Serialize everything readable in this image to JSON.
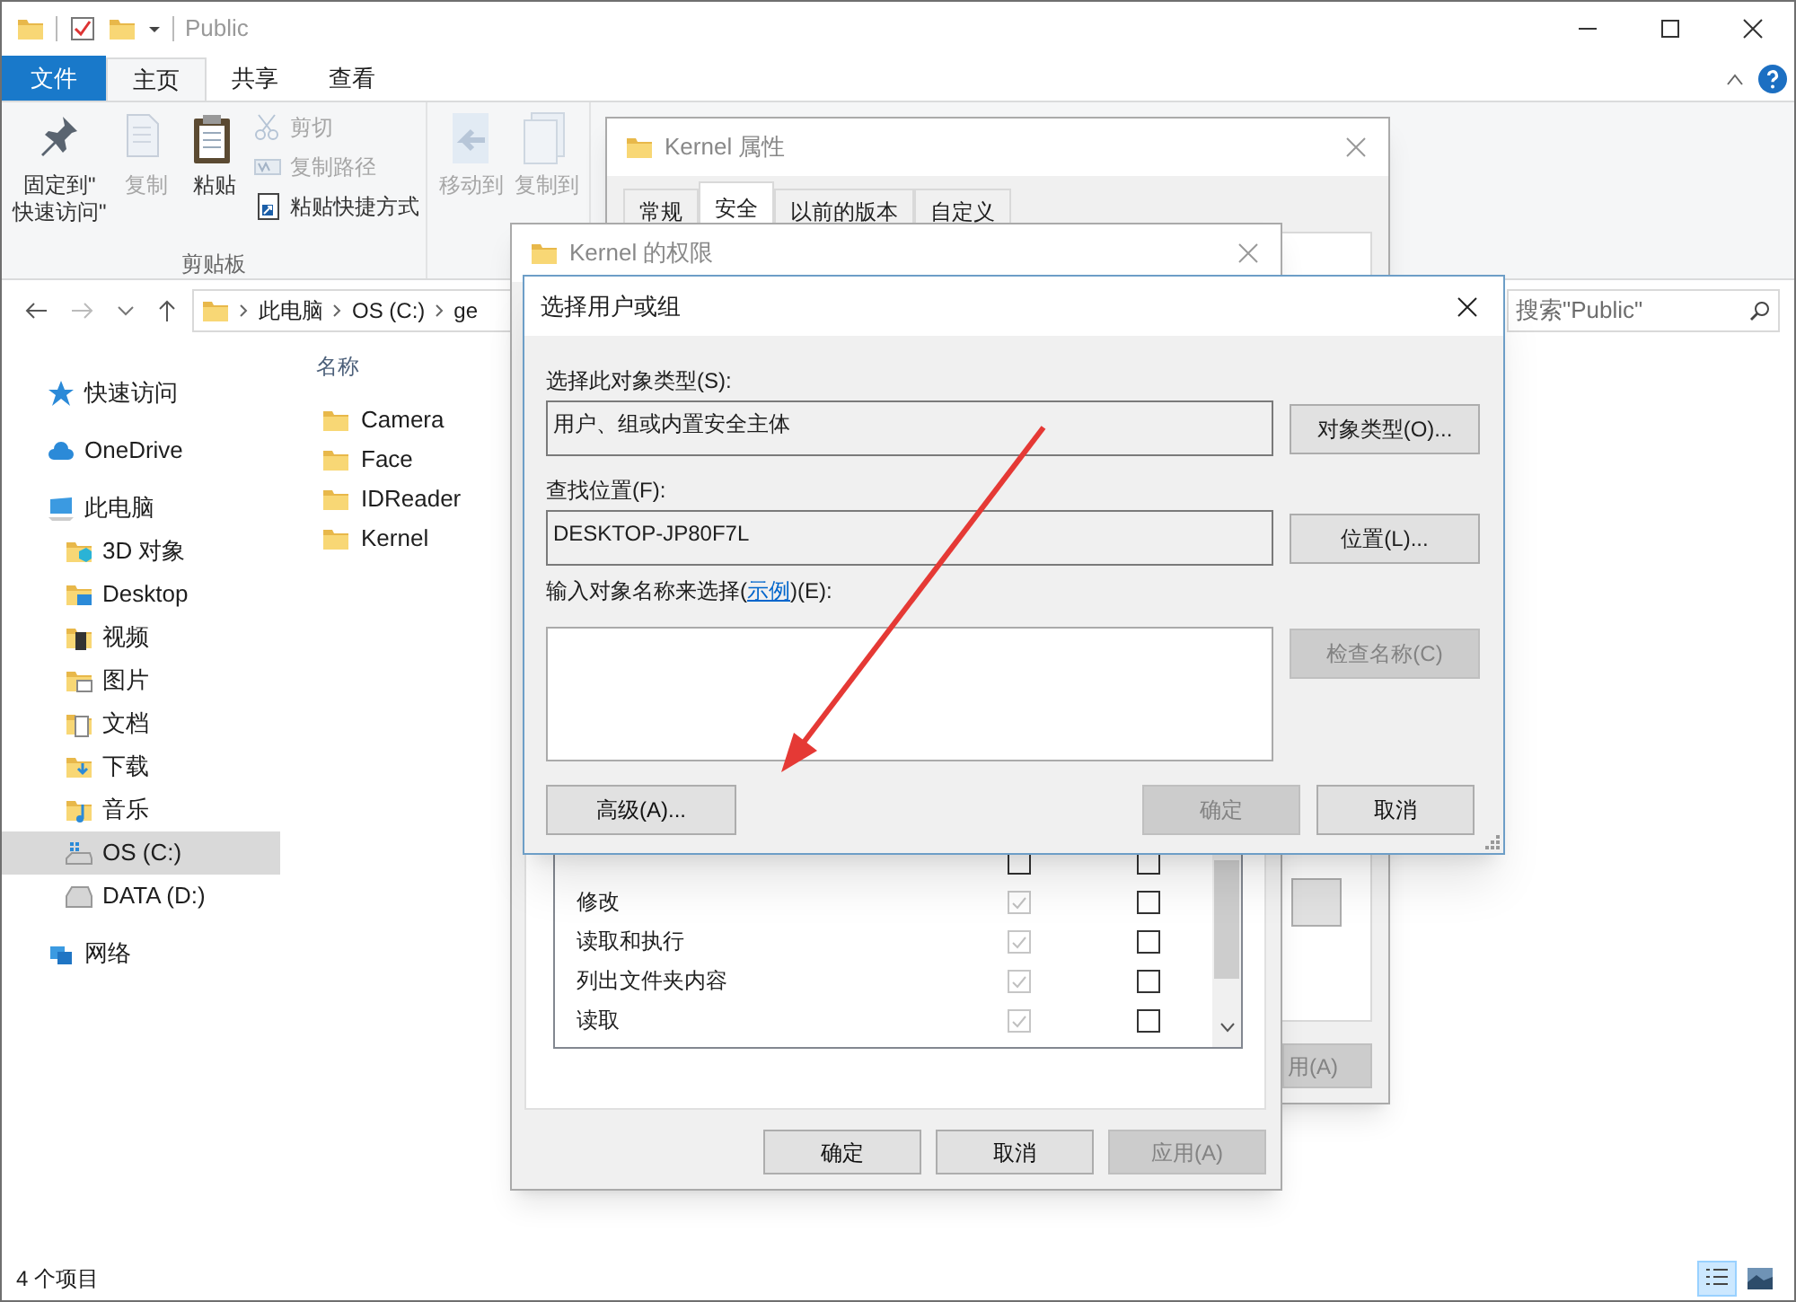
{
  "explorer": {
    "title": "Public",
    "window_tabs": [
      {
        "label": "文件",
        "kind": "file",
        "selected": false
      },
      {
        "label": "主页",
        "kind": "tab",
        "selected": true
      },
      {
        "label": "共享",
        "kind": "tab",
        "selected": false
      },
      {
        "label": "查看",
        "kind": "tab",
        "selected": false
      }
    ],
    "ribbon": {
      "groups": [
        {
          "label": "剪贴板",
          "large": [
            {
              "label": "固定到\"\n快速访问\"",
              "kind": "pin",
              "disabled": false
            },
            {
              "label": "复制",
              "kind": "copy",
              "disabled": true
            },
            {
              "label": "粘贴",
              "kind": "paste",
              "disabled": false
            }
          ],
          "small": [
            {
              "label": "剪切",
              "kind": "cut",
              "disabled": true
            },
            {
              "label": "复制路径",
              "kind": "copy-path",
              "disabled": true
            },
            {
              "label": "粘贴快捷方式",
              "kind": "shortcut",
              "disabled": false
            }
          ]
        },
        {
          "large": [
            {
              "label": "移动到",
              "kind": "move",
              "disabled": true
            },
            {
              "label": "复制到",
              "kind": "copy-to",
              "disabled": true
            }
          ]
        }
      ]
    },
    "breadcrumb": [
      "此电脑",
      "OS (C:)",
      "ge"
    ],
    "search": {
      "placeholder": "搜索\"Public\""
    },
    "nav_pane": [
      {
        "label": "快速访问",
        "kind": "star",
        "selected": false
      },
      {
        "label": "OneDrive",
        "kind": "cloud",
        "selected": false
      },
      {
        "label": "此电脑",
        "kind": "pc",
        "selected": false,
        "children": [
          {
            "label": "3D 对象",
            "kind": "folder-3d",
            "selected": false
          },
          {
            "label": "Desktop",
            "kind": "folder-desktop",
            "selected": false
          },
          {
            "label": "视频",
            "kind": "folder-video",
            "selected": false
          },
          {
            "label": "图片",
            "kind": "folder-pictures",
            "selected": false
          },
          {
            "label": "文档",
            "kind": "folder-docs",
            "selected": false
          },
          {
            "label": "下载",
            "kind": "folder-downloads",
            "selected": false
          },
          {
            "label": "音乐",
            "kind": "folder-music",
            "selected": false
          },
          {
            "label": "OS (C:)",
            "kind": "drive-os",
            "selected": true
          },
          {
            "label": "DATA (D:)",
            "kind": "drive",
            "selected": false
          }
        ]
      },
      {
        "label": "网络",
        "kind": "network",
        "selected": false
      }
    ],
    "file_list": {
      "columns": [
        "名称"
      ],
      "items": [
        "Camera",
        "Face",
        "IDReader",
        "Kernel"
      ]
    },
    "status_bar": {
      "text": "4 个项目",
      "views": [
        {
          "kind": "details",
          "selected": true
        },
        {
          "kind": "thumbnails",
          "selected": false
        }
      ]
    }
  },
  "properties_dialog": {
    "title": "Kernel 属性",
    "tabs": [
      {
        "label": "常规",
        "selected": false
      },
      {
        "label": "安全",
        "selected": true
      },
      {
        "label": "以前的版本",
        "selected": false
      },
      {
        "label": "自定义",
        "selected": false
      }
    ],
    "apply_fragment": "用(A)"
  },
  "permissions_dialog": {
    "title": "Kernel 的权限",
    "rows": [
      {
        "allow": false,
        "allow_disabled": false,
        "deny": false
      },
      {
        "name": "修改",
        "allow": true,
        "allow_disabled": true,
        "deny": false
      },
      {
        "name": "读取和执行",
        "allow": true,
        "allow_disabled": true,
        "deny": false
      },
      {
        "name": "列出文件夹内容",
        "allow": true,
        "allow_disabled": true,
        "deny": false
      },
      {
        "name": "读取",
        "allow": true,
        "allow_disabled": true,
        "deny": false
      }
    ],
    "buttons": [
      {
        "label": "确定",
        "disabled": false
      },
      {
        "label": "取消",
        "disabled": false
      },
      {
        "label": "应用(A)",
        "disabled": true
      }
    ]
  },
  "select_dialog": {
    "title": "选择用户或组",
    "object_type": {
      "label": "选择此对象类型(S):",
      "value": "用户、组或内置安全主体",
      "button": "对象类型(O)..."
    },
    "location": {
      "label": "查找位置(F):",
      "value": "DESKTOP-JP80F7L",
      "button": "位置(L)..."
    },
    "names": {
      "label_before": "输入对象名称来选择(",
      "link": "示例",
      "label_after": ")(E):"
    },
    "check_button": {
      "label": "检查名称(C)",
      "disabled": true
    },
    "buttons": [
      {
        "label": "高级(A)...",
        "disabled": false
      },
      {
        "label": "确定",
        "disabled": true
      },
      {
        "label": "取消",
        "disabled": false
      }
    ]
  }
}
